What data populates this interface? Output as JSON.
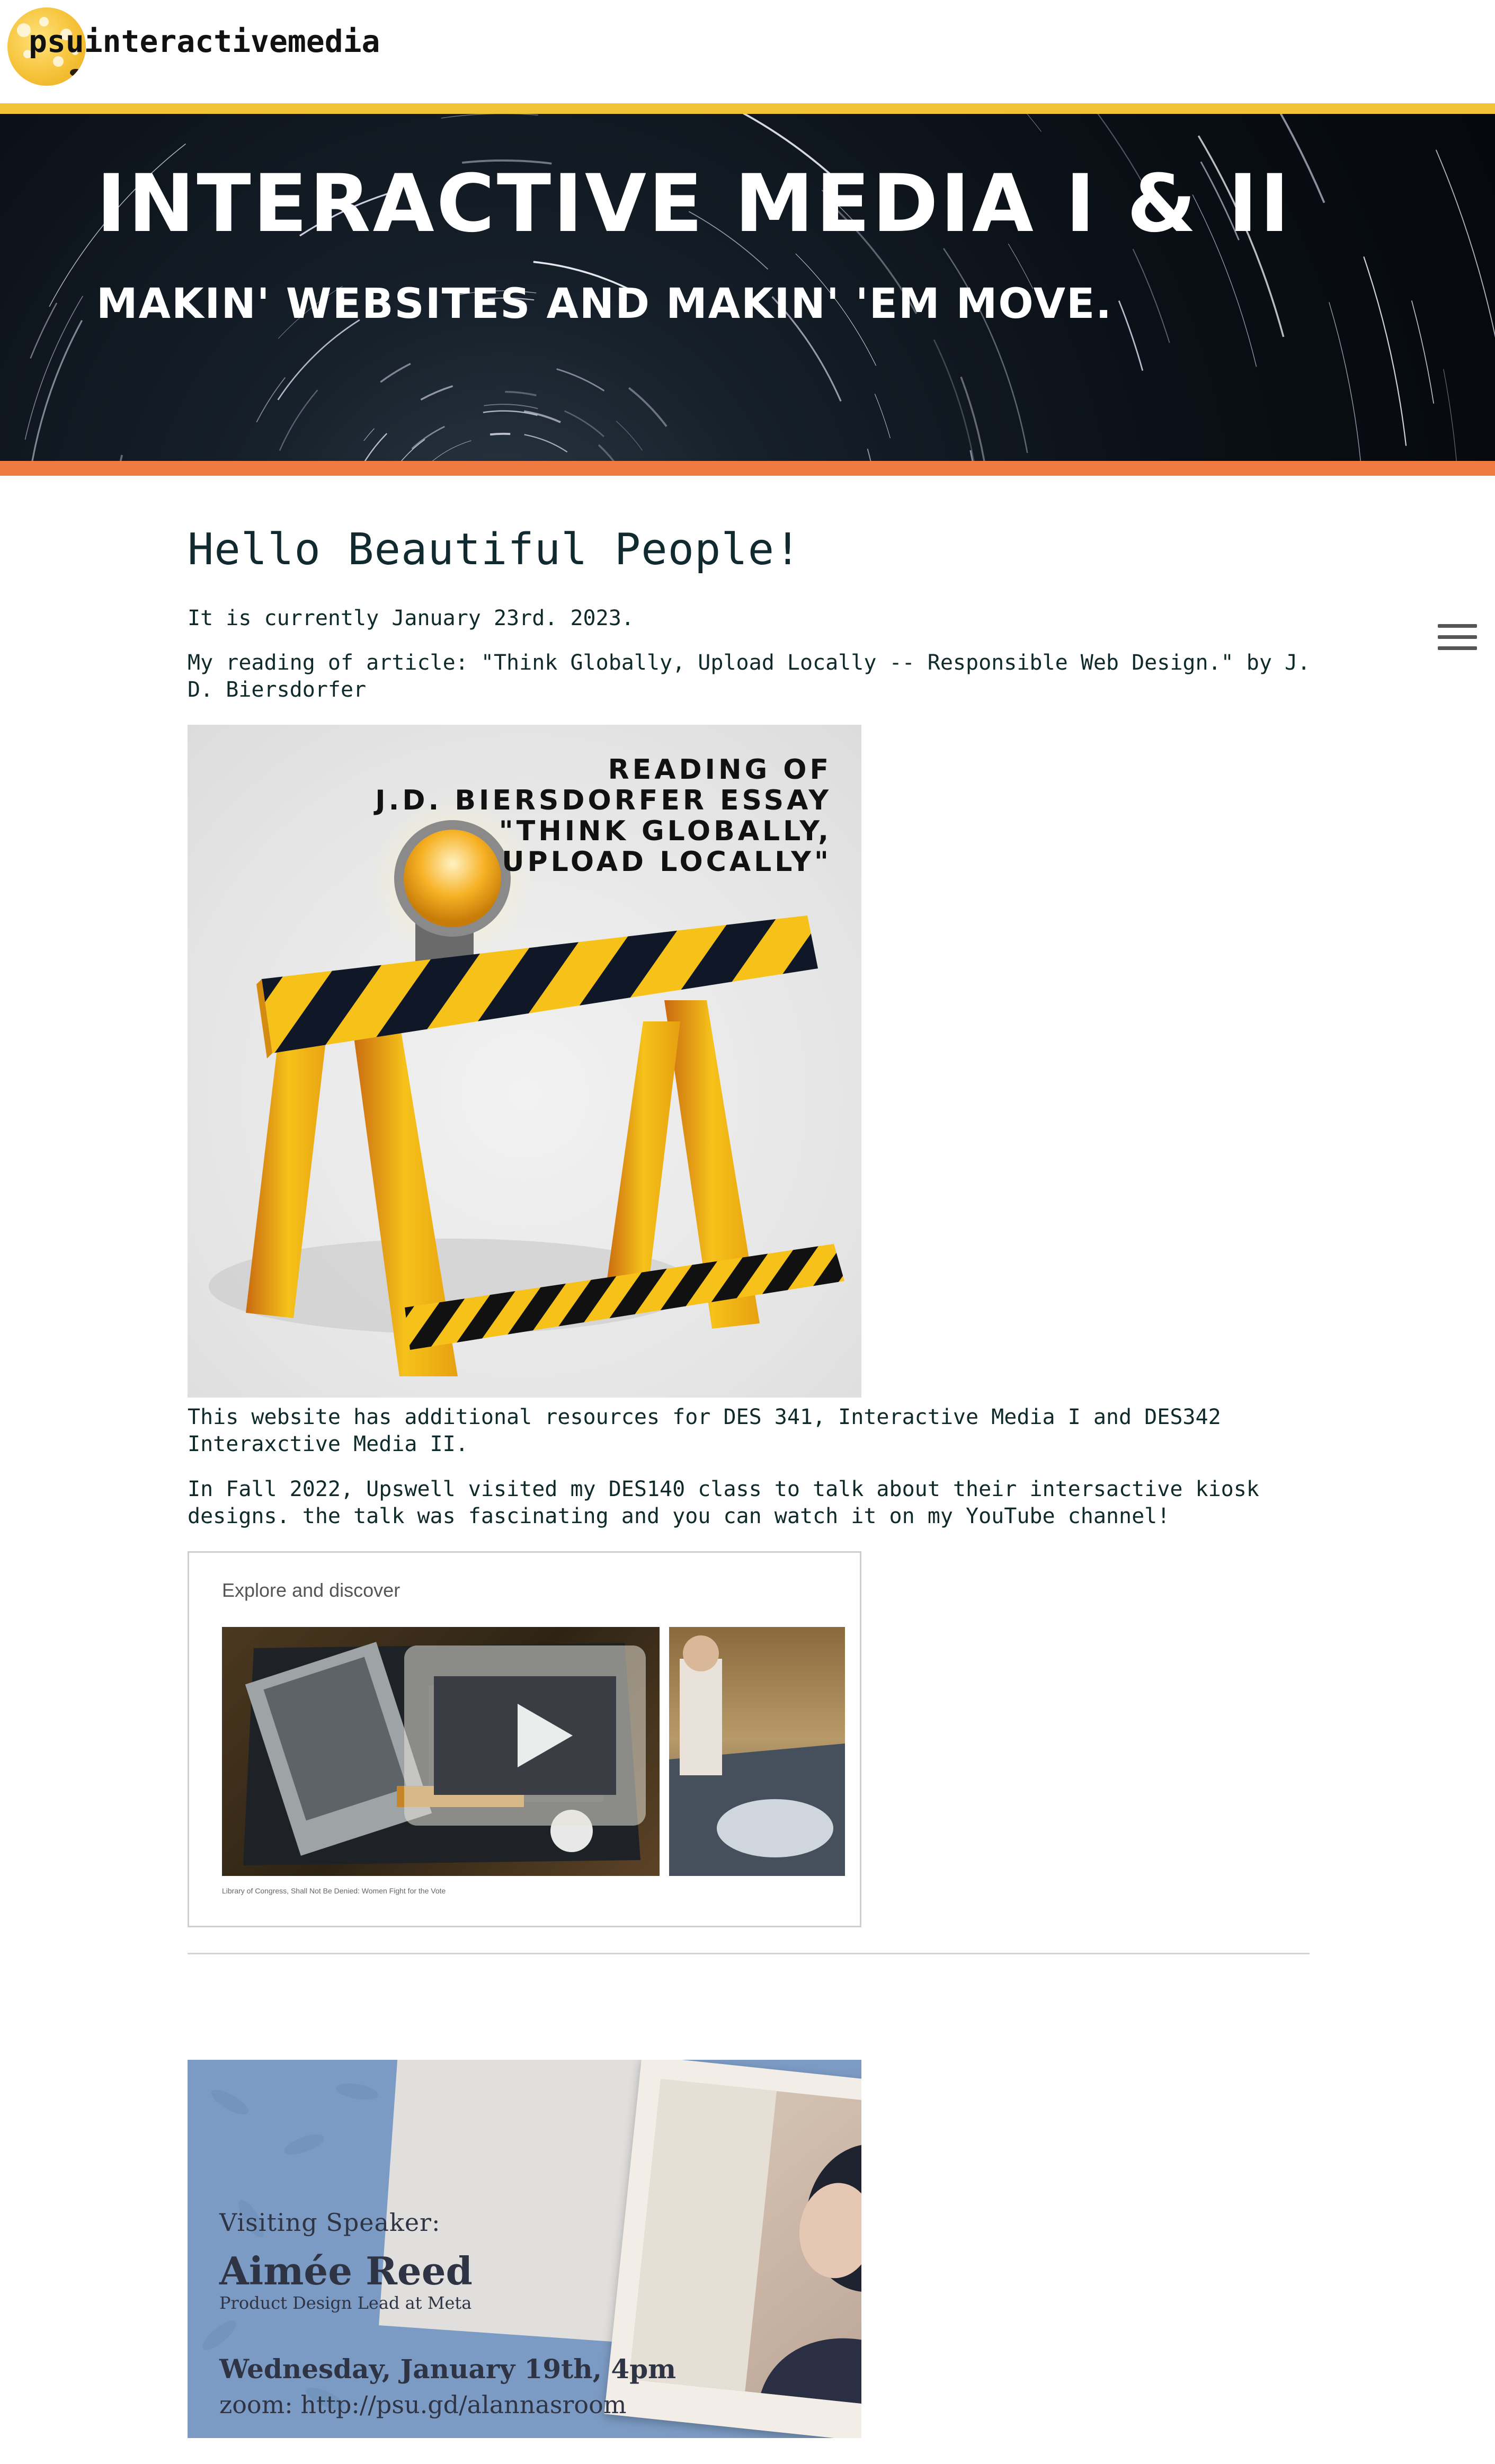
{
  "site": {
    "name": "psuinteractivemedia"
  },
  "hero": {
    "title": "Interactive Media I & II",
    "subtitle": "Makin' websites and makin' 'em move."
  },
  "colors": {
    "accent_yellow": "#f2c335",
    "accent_orange": "#ef7b43",
    "text": "#0f2a2a"
  },
  "main": {
    "heading": "Hello Beautiful People!",
    "date_line": "It is currently January 23rd. 2023.",
    "reading_line": "My reading of article: \"Think Globally, Upload Locally -- Responsible Web Design.\" by J. D. Biersdorfer",
    "barricade_caption": [
      "READING OF",
      "J.D. BIERSDORFER ESSAY",
      "\"THINK GLOBALLY,",
      "UPLOAD LOCALLY\""
    ],
    "resources_line": "This website has additional resources for DES 341, Interactive Media I and DES342 Interaxctive Media II.",
    "upswell_line": "In Fall 2022, Upswell visited my DES140 class to talk about their intersactive kiosk designs. the talk was fascinating and you can watch it on my YouTube channel!",
    "video": {
      "heading": "Explore and discover",
      "caption": "Library of Congress, Shall Not Be Denied: Women Fight for the Vote",
      "icon": "play-icon"
    },
    "speaker": {
      "label": "Visiting Speaker:",
      "name": "Aimée Reed",
      "role": "Product Design Lead at Meta",
      "date": "Wednesday, January 19th, 4pm",
      "zoom": "zoom: http://psu.gd/alannasroom"
    }
  },
  "menu": {
    "icon": "hamburger-menu-icon"
  }
}
